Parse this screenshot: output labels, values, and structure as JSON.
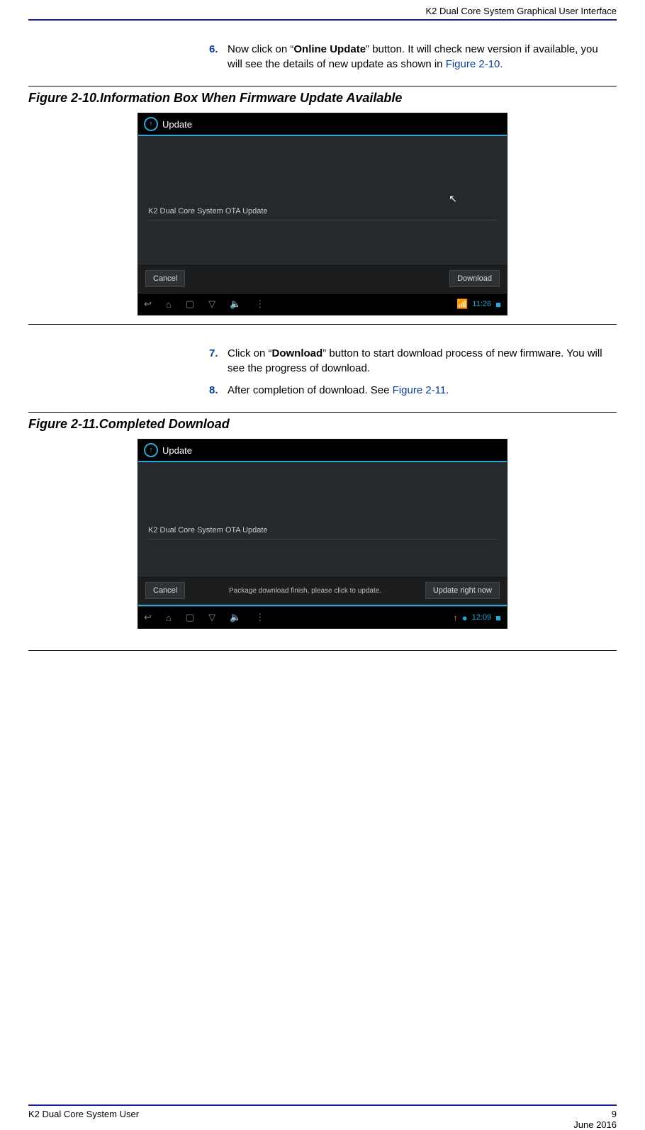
{
  "header": {
    "running_title": "K2 Dual Core System Graphical User Interface"
  },
  "steps_a": {
    "num": "6.",
    "pre": "Now click on “",
    "bold": "Online Update",
    "post": "” button. It will check new version if available, you will see the details of new update as shown in ",
    "xref": "Figure 2-10."
  },
  "fig1": {
    "caption": "Figure 2-10.Information Box When Firmware Update Available",
    "top_label": "Update",
    "msg": "K2 Dual Core System OTA Update",
    "cancel": "Cancel",
    "download": "Download",
    "clock": "11:26"
  },
  "steps_b": [
    {
      "num": "7.",
      "pre": "Click on “",
      "bold": "Download",
      "post": "” button to start download process of new firmware. You will see the progress of download.",
      "xref": ""
    },
    {
      "num": "8.",
      "pre": "After completion of download. See ",
      "bold": "",
      "post": "",
      "xref": "Figure 2-11."
    }
  ],
  "fig2": {
    "caption": "Figure 2-11.Completed Download",
    "top_label": "Update",
    "msg": "K2 Dual Core System OTA Update",
    "pkg": "Package download finish, please click to update.",
    "cancel": "Cancel",
    "update_now": "Update right now",
    "clock": "12:09"
  },
  "footer": {
    "left": "K2 Dual Core System User",
    "page": "9",
    "date": "June 2016"
  }
}
